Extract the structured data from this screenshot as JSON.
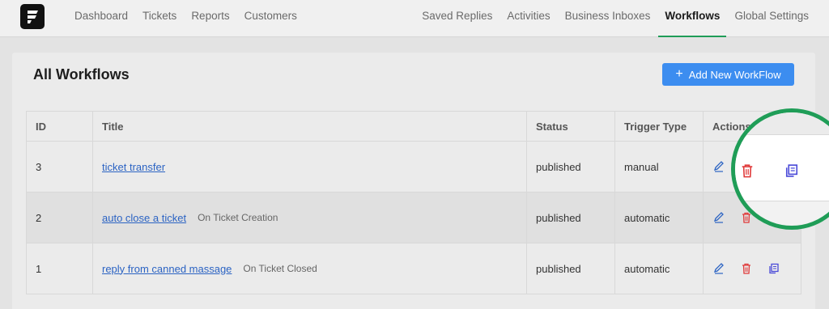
{
  "nav": {
    "left": [
      "Dashboard",
      "Tickets",
      "Reports",
      "Customers"
    ],
    "right": [
      "Saved Replies",
      "Activities",
      "Business Inboxes",
      "Workflows",
      "Global Settings"
    ],
    "active": "Workflows"
  },
  "page": {
    "title": "All Workflows",
    "add_button": "Add New WorkFlow"
  },
  "table": {
    "columns": [
      "ID",
      "Title",
      "Status",
      "Trigger Type",
      "Actions"
    ],
    "rows": [
      {
        "id": "3",
        "title": "ticket transfer",
        "event": "",
        "status": "published",
        "trigger": "manual"
      },
      {
        "id": "2",
        "title": "auto close a ticket",
        "event": "On Ticket Creation",
        "status": "published",
        "trigger": "automatic"
      },
      {
        "id": "1",
        "title": "reply from canned massage",
        "event": "On Ticket Closed",
        "status": "published",
        "trigger": "automatic"
      }
    ]
  },
  "icons": {
    "logo": "app-logo",
    "add": "plus-icon",
    "edit": "pencil-icon",
    "delete": "trash-icon",
    "duplicate": "copy-icon"
  },
  "colors": {
    "accent": "#1f9d57",
    "primary_button": "#3c8df0",
    "link": "#2b63c3",
    "edit_icon": "#2b63c3",
    "delete_icon": "#e03a3a",
    "duplicate_icon": "#4a4ad8"
  }
}
